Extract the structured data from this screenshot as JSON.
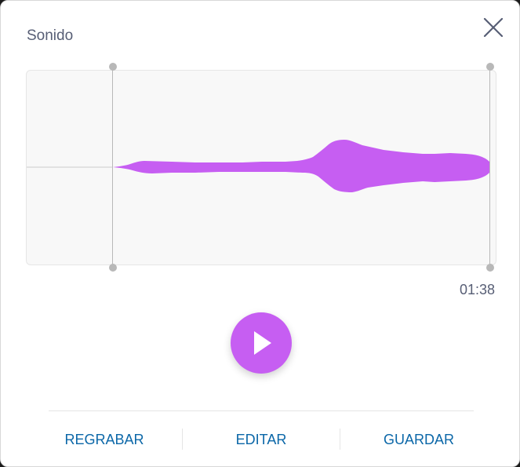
{
  "dialog": {
    "title": "Sonido",
    "close_icon": "close-icon"
  },
  "waveform": {
    "color": "#c65ef2",
    "handle_color": "#b8b8b8",
    "duration": "01:38"
  },
  "player": {
    "play_icon": "play-icon",
    "accent": "#c65ef2"
  },
  "actions": {
    "rerecord": "REGRABAR",
    "edit": "EDITAR",
    "save": "GUARDAR",
    "color": "#0b67a8"
  }
}
